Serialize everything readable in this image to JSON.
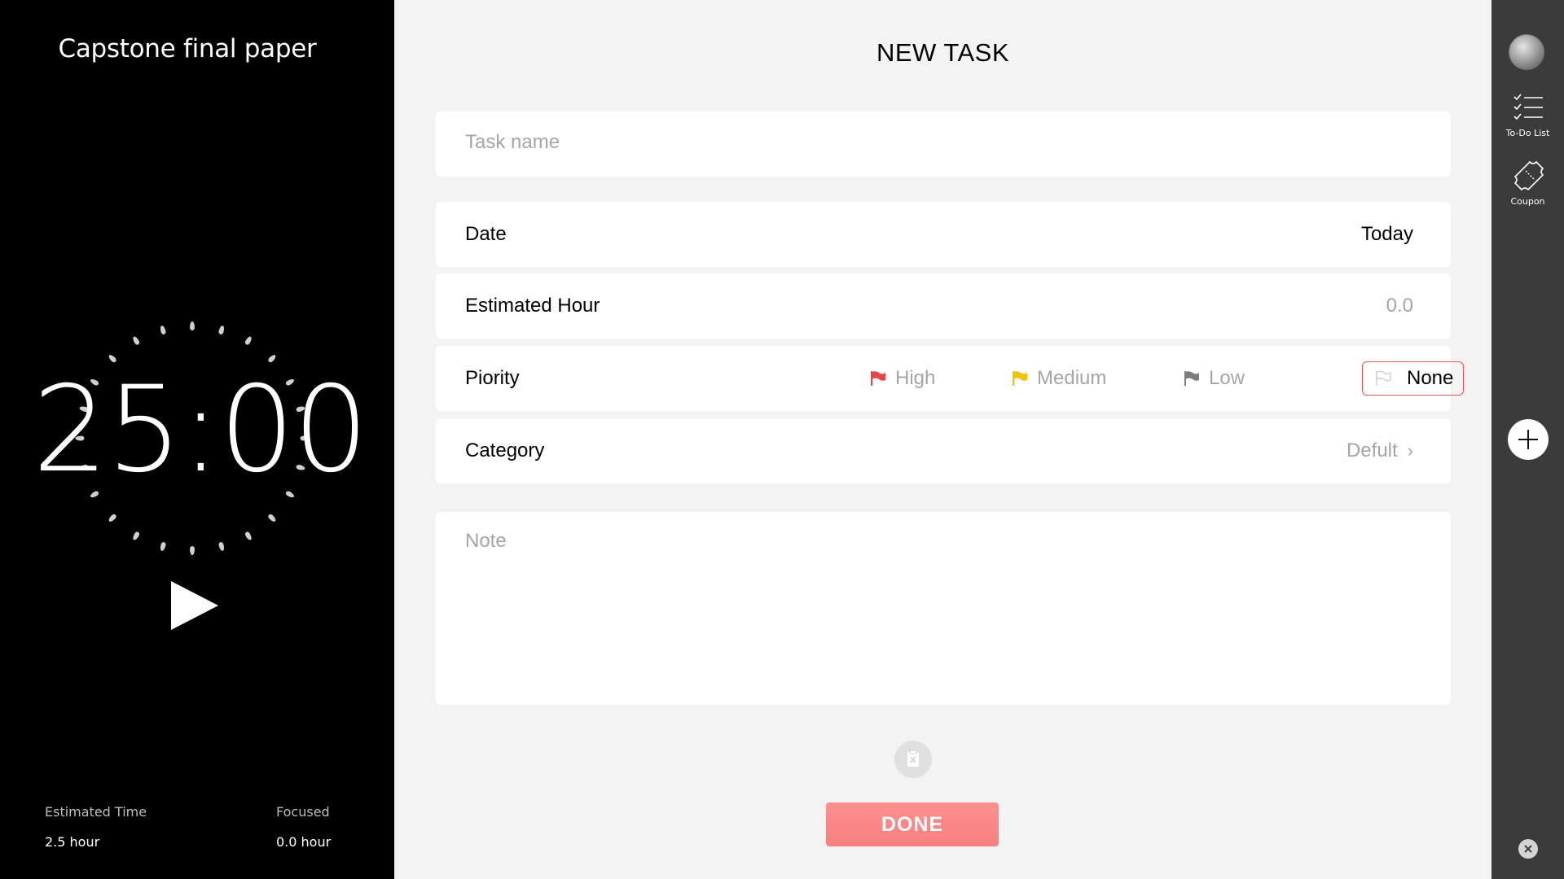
{
  "left_panel": {
    "task_title": "Capstone final paper",
    "timer": "25:00",
    "estimated_time_label": "Estimated Time",
    "estimated_time_value": "2.5 hour",
    "focused_label": "Focused",
    "focused_value": "0.0 hour"
  },
  "form": {
    "title": "NEW TASK",
    "task_name_placeholder": "Task name",
    "date_label": "Date",
    "date_value": "Today",
    "estimated_hour_label": "Estimated Hour",
    "estimated_hour_value": "0.0",
    "priority_label": "Piority",
    "priority_options": [
      {
        "label": "High",
        "color": "#e84545"
      },
      {
        "label": "Medium",
        "color": "#f2c200"
      },
      {
        "label": "Low",
        "color": "#7d7d7d"
      },
      {
        "label": "None",
        "color": "#d0d0d0"
      }
    ],
    "priority_selected": "None",
    "category_label": "Category",
    "category_value": "Defult",
    "note_placeholder": "Note",
    "done_label": "DONE"
  },
  "rail": {
    "todo_label": "To-Do List",
    "coupon_label": "Coupon"
  },
  "colors": {
    "accent": "#f58080",
    "selected_border": "#e4585a"
  }
}
